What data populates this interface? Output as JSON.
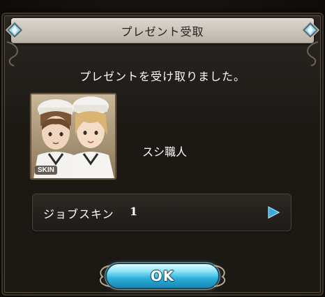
{
  "dialog": {
    "title": "プレゼント受取",
    "message": "プレゼントを受け取りました。"
  },
  "item": {
    "name": "スシ職人",
    "thumbnail_icon": "sushi-chef-skin-portrait",
    "badge": "SKIN"
  },
  "reward_row": {
    "label": "ジョブスキン",
    "count": "1",
    "arrow_icon": "play-triangle-icon"
  },
  "ok_button": {
    "label": "OK"
  },
  "colors": {
    "accent": "#2db0d9",
    "title_bar": "#cfc9bf",
    "panel": "#1e1b17"
  }
}
